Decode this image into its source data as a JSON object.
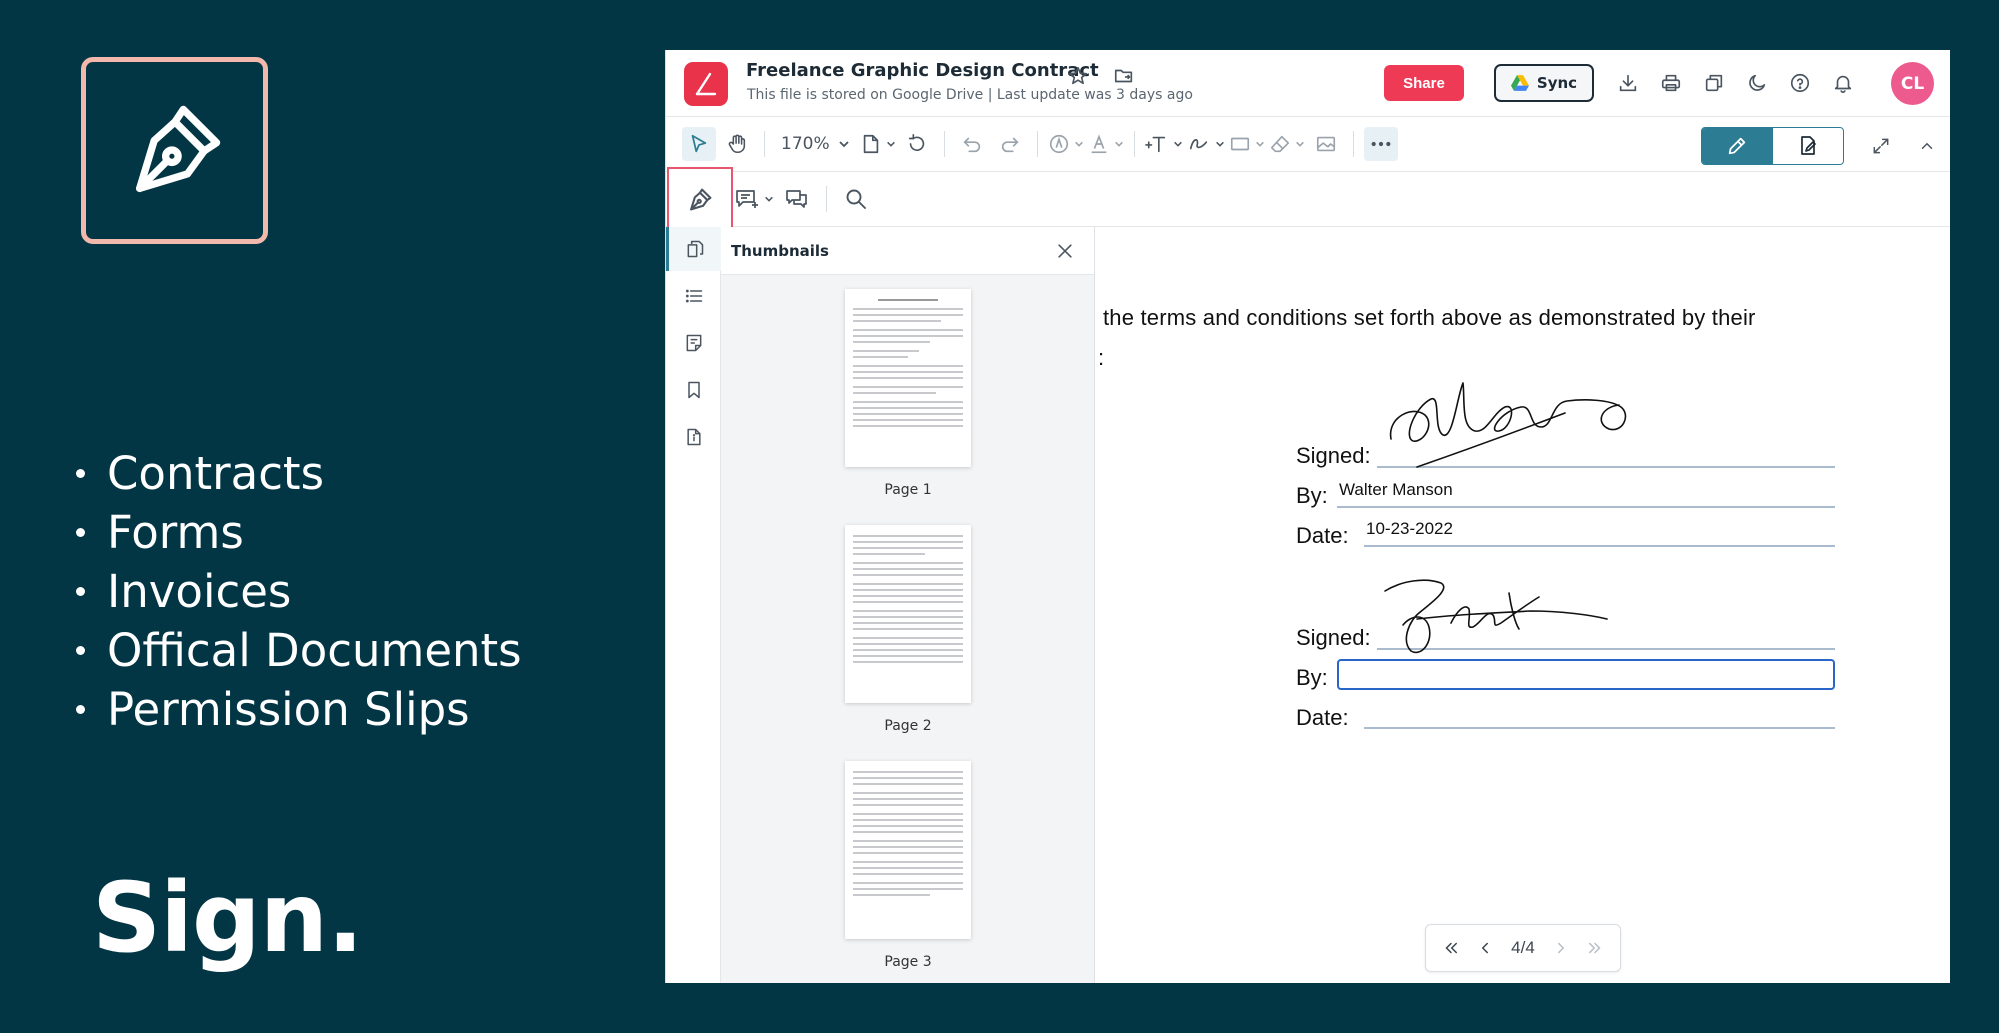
{
  "promo": {
    "bullets": [
      "Contracts",
      "Forms",
      "Invoices",
      "Offical Documents",
      "Permission Slips"
    ],
    "headline": "Sign."
  },
  "header": {
    "title": "Freelance Graphic Design Contract",
    "subtitle": "This file is stored on Google Drive | Last update was 3 days ago",
    "share_label": "Share",
    "sync_label": "Sync",
    "avatar_initials": "CL"
  },
  "toolbar": {
    "zoom": "170%"
  },
  "thumbnails": {
    "title": "Thumbnails",
    "pages": [
      "Page 1",
      "Page 2",
      "Page 3"
    ]
  },
  "document": {
    "line1": "the terms and conditions set forth above as demonstrated by their",
    "line2": ":",
    "block1": {
      "signed_label": "Signed:",
      "by_label": "By:",
      "by_value": "Walter Manson",
      "date_label": "Date:",
      "date_value": "10-23-2022"
    },
    "block2": {
      "signed_label": "Signed:",
      "by_label": "By:",
      "by_value": "",
      "date_label": "Date:"
    }
  },
  "pager": {
    "indicator": "4/4"
  },
  "colors": {
    "background": "#023645",
    "accent_red": "#ee3a55",
    "accent_teal": "#2c7d93",
    "logo_border": "#f2b8ac",
    "avatar": "#ec5a8e"
  }
}
